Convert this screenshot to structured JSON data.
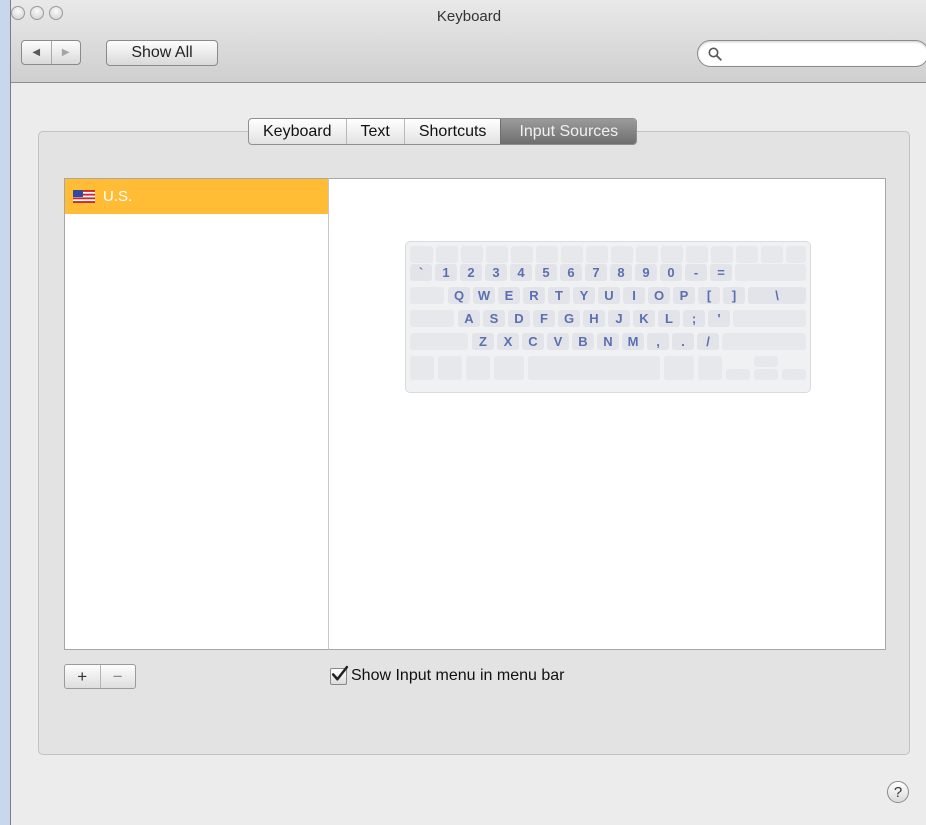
{
  "window": {
    "title": "Keyboard"
  },
  "toolbar": {
    "back_icon": "◀",
    "forward_icon": "▶",
    "show_all_label": "Show All",
    "search_placeholder": "",
    "search_icon": "magnifier-icon"
  },
  "tabs": [
    {
      "label": "Keyboard",
      "selected": false
    },
    {
      "label": "Text",
      "selected": false
    },
    {
      "label": "Shortcuts",
      "selected": false
    },
    {
      "label": "Input Sources",
      "selected": true
    }
  ],
  "input_sources": {
    "items": [
      {
        "label": "U.S.",
        "icon": "us-flag-icon",
        "selected": true
      }
    ],
    "selection_color": "#ffbc34"
  },
  "keyboard_preview": {
    "rows": [
      [
        "`",
        "1",
        "2",
        "3",
        "4",
        "5",
        "6",
        "7",
        "8",
        "9",
        "0",
        "-",
        "="
      ],
      [
        "Q",
        "W",
        "E",
        "R",
        "T",
        "Y",
        "U",
        "I",
        "O",
        "P",
        "[",
        "]",
        "\\"
      ],
      [
        "A",
        "S",
        "D",
        "F",
        "G",
        "H",
        "J",
        "K",
        "L",
        ";",
        "'"
      ],
      [
        "Z",
        "X",
        "C",
        "V",
        "B",
        "N",
        "M",
        ",",
        ".",
        "/"
      ]
    ],
    "key_color": "#5a70b0"
  },
  "controls": {
    "add_label": "+",
    "remove_label": "−",
    "show_input_menu_label": "Show Input menu in menu bar",
    "show_input_menu_checked": true,
    "help_label": "?"
  }
}
